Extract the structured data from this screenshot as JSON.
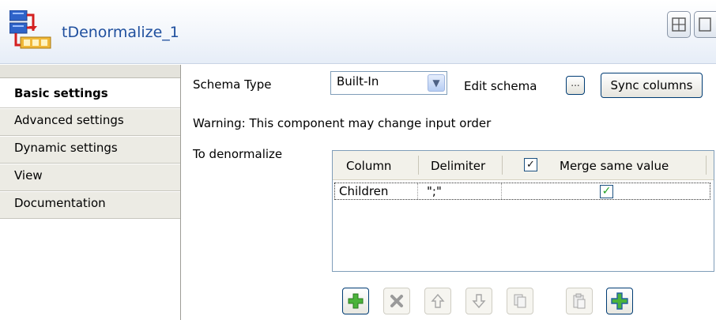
{
  "header": {
    "title": "tDenormalize_1",
    "icon": "tdenormalize-component-icon"
  },
  "tabs": [
    {
      "label": "Basic settings",
      "active": true
    },
    {
      "label": "Advanced settings",
      "active": false
    },
    {
      "label": "Dynamic settings",
      "active": false
    },
    {
      "label": "View",
      "active": false
    },
    {
      "label": "Documentation",
      "active": false
    }
  ],
  "schema": {
    "label": "Schema Type",
    "value": "Built-In",
    "edit_label": "Edit schema",
    "edit_button": "...",
    "sync_label": "Sync columns"
  },
  "warning": "Warning: This component may change input order",
  "denormalize": {
    "label": "To denormalize",
    "columns": [
      "Column",
      "Delimiter",
      "Merge same value"
    ],
    "header_checkbox_checked": true,
    "rows": [
      {
        "column": "Children",
        "delimiter": "\";\"",
        "merge": true
      }
    ]
  },
  "toolbar": [
    {
      "name": "add-icon",
      "enabled": true
    },
    {
      "name": "remove-icon",
      "enabled": false
    },
    {
      "name": "move-up-icon",
      "enabled": false
    },
    {
      "name": "move-down-icon",
      "enabled": false
    },
    {
      "name": "copy-icon",
      "enabled": false
    },
    {
      "name": "paste-icon",
      "enabled": false
    },
    {
      "name": "add-all-icon",
      "enabled": true
    }
  ],
  "colors": {
    "title": "#1f4f9e",
    "check": "#21a121",
    "add_green": "#4bb33a"
  }
}
